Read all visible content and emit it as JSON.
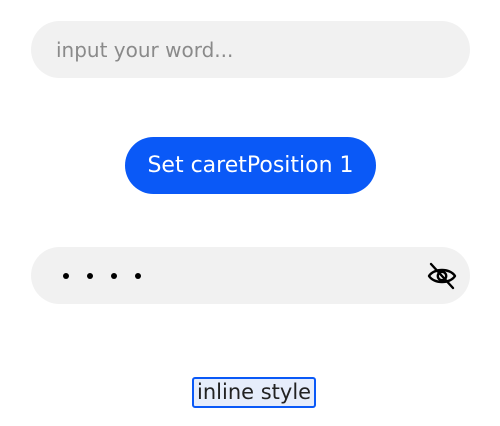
{
  "text_input": {
    "placeholder": "input your word..."
  },
  "caret_button": {
    "label": "Set caretPosition 1"
  },
  "password_input": {
    "masked_length": 4,
    "toggle_icon": "eye-off-icon"
  },
  "inline_input": {
    "value": "inline style"
  },
  "colors": {
    "accent": "#0a59f7",
    "input_background": "#f1f1f1",
    "placeholder_text": "#8a8a8a"
  }
}
